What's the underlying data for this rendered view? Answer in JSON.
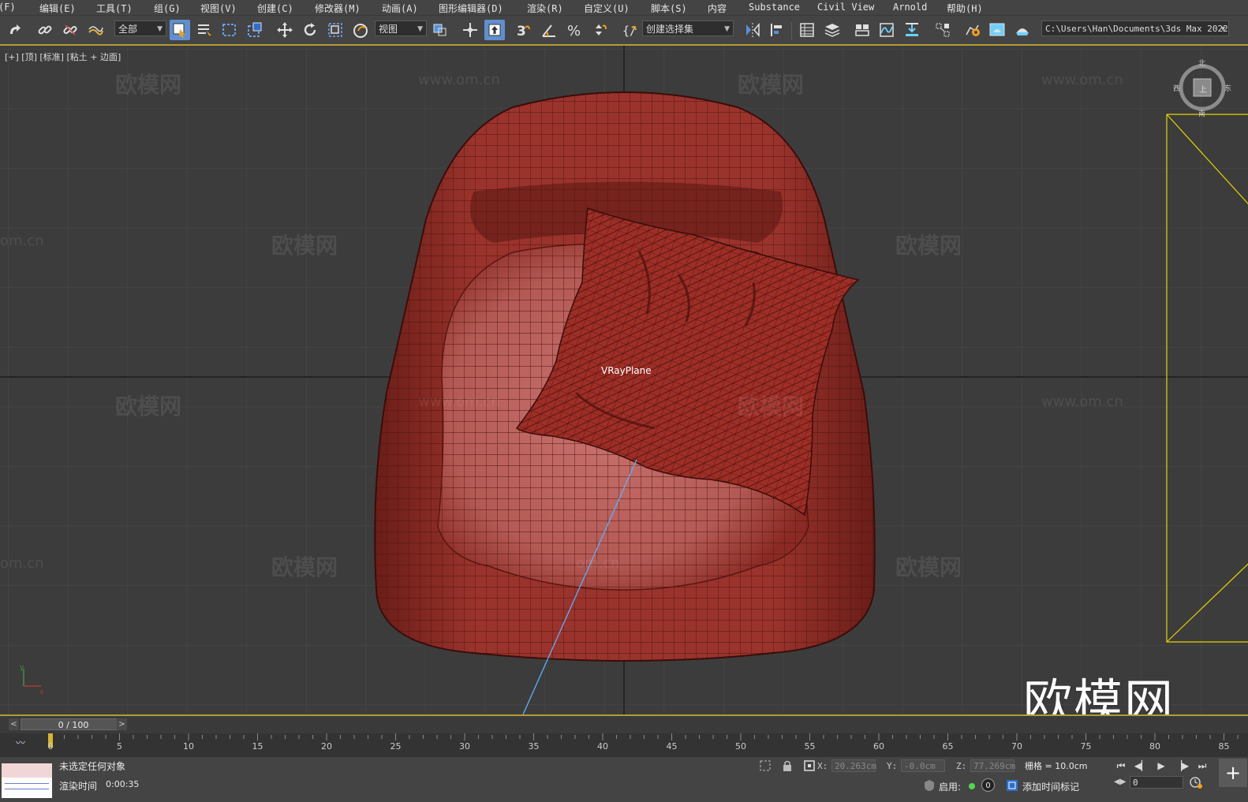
{
  "menu": [
    "(F)",
    "编辑(E)",
    "工具(T)",
    "组(G)",
    "视图(V)",
    "创建(C)",
    "修改器(M)",
    "动画(A)",
    "图形编辑器(D)",
    "渲染(R)",
    "自定义(U)",
    "脚本(S)",
    "内容",
    "Substance",
    "Civil View",
    "Arnold",
    "帮助(H)"
  ],
  "toolbar": {
    "selection_filter": "全部",
    "reference_coord": "视图",
    "named_selection": "创建选择集",
    "project_path": "C:\\Users\\Han\\Documents\\3ds Max 2022"
  },
  "viewport": {
    "label": "[+] [顶] [标准] [粘土 + 边面]",
    "object_label": "VRayPlane",
    "watermark_cn": "欧模网",
    "watermark_url": "www.om.cn",
    "watermark_url_partial": "om.cn",
    "logo_watermark": "欧模网",
    "viewcube": {
      "north": "北",
      "south": "南",
      "west": "西",
      "east": "东",
      "face": "上"
    }
  },
  "time_slider": {
    "value": "0 / 100",
    "prev": "<",
    "next": ">"
  },
  "timeline_ticks": [
    "0",
    "5",
    "10",
    "15",
    "20",
    "25",
    "30",
    "35",
    "40",
    "45",
    "50",
    "55",
    "60",
    "65",
    "70",
    "75",
    "80",
    "85"
  ],
  "status": {
    "selection": "未选定任何对象",
    "render_time_label": "渲染时间",
    "render_time": "0:00:35",
    "x_label": "X:",
    "x_value": "20.263cm",
    "y_label": "Y:",
    "y_value": "-0.0cm",
    "z_label": "Z:",
    "z_value": "77.269cm",
    "grid": "栅格 = 10.0cm",
    "enable_label": "启用:",
    "enable_count": "0",
    "add_time_tag": "添加时间标记",
    "frame_input": "0"
  },
  "colors": {
    "ui_bg": "#444444",
    "viewport_bg": "#3c3c3c",
    "model_red": "#8b2a24",
    "accent_gold": "#b59a32",
    "camera_frame": "#e6d400",
    "active_blue": "#5f8fd0"
  }
}
